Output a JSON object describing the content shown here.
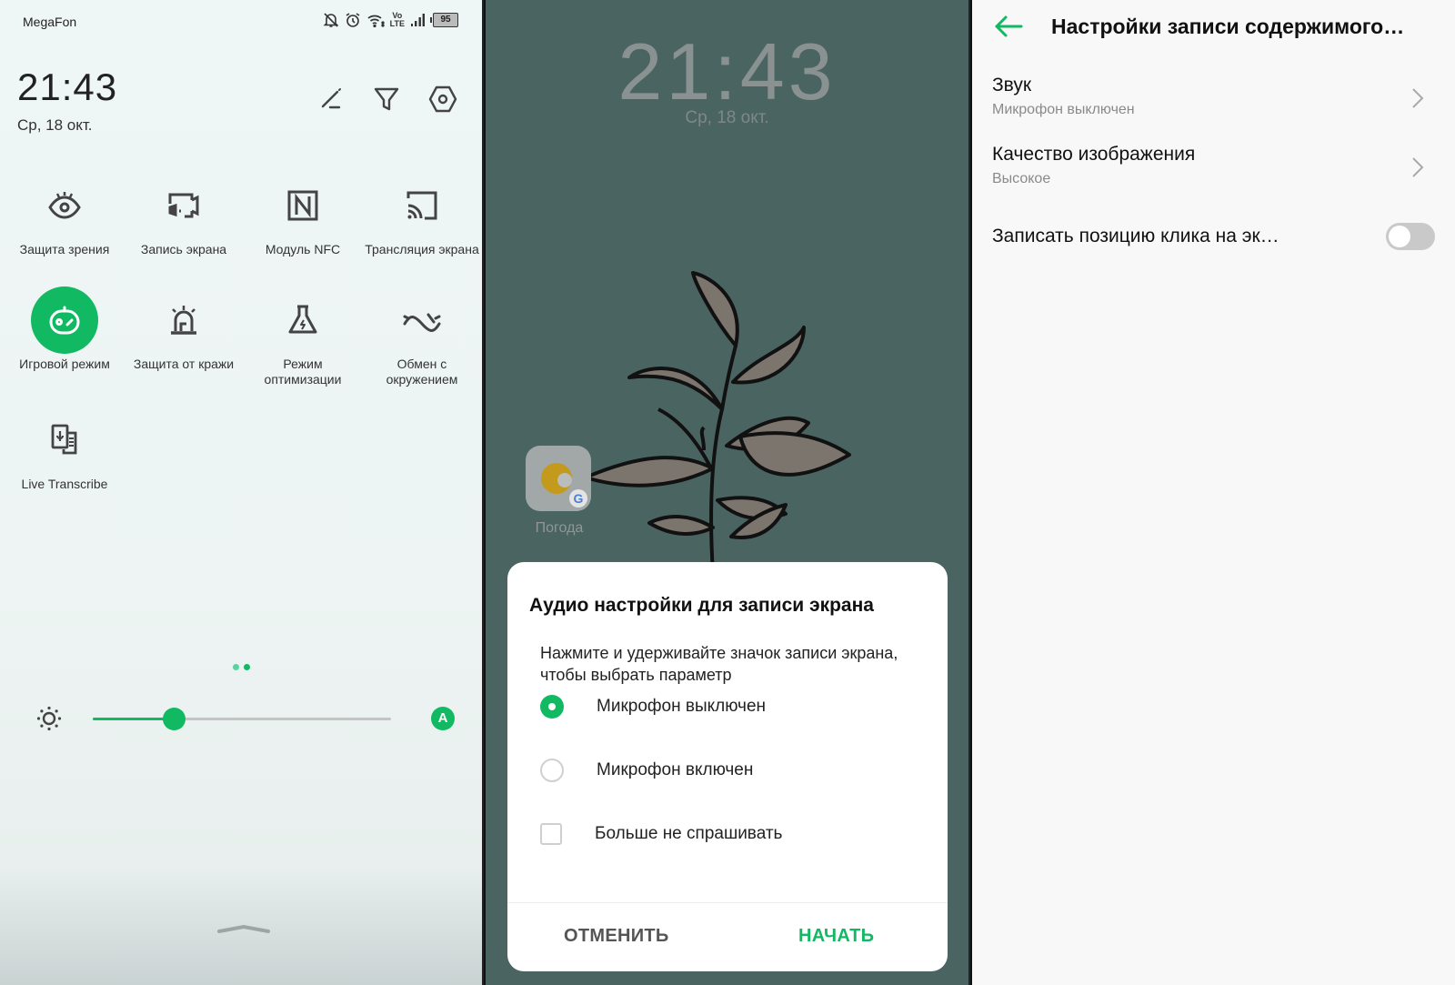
{
  "quick_settings": {
    "status_bar": {
      "carrier": "MegaFon",
      "icons": [
        "bell-off-icon",
        "alarm-icon",
        "wifi-icon",
        "volte-icon",
        "signal-icon",
        "battery-icon"
      ],
      "volte_top": "Vo",
      "volte_bottom": "LTE",
      "battery_level": "95"
    },
    "time": "21:43",
    "date": "Ср, 18 окт.",
    "header_actions": [
      "edit-icon",
      "filter-icon",
      "settings-icon"
    ],
    "tiles": [
      {
        "label": "Защита зрения",
        "icon": "eye-icon",
        "active": false
      },
      {
        "label": "Запись экрана",
        "icon": "screen-record-icon",
        "active": false
      },
      {
        "label": "Модуль NFC",
        "icon": "nfc-icon",
        "active": false
      },
      {
        "label": "Трансляция экрана",
        "icon": "cast-icon",
        "active": false
      },
      {
        "label": "Игровой режим",
        "icon": "game-mode-icon",
        "active": true
      },
      {
        "label": "Защита от кражи",
        "icon": "alarm-siren-icon",
        "active": false
      },
      {
        "label": "Режим оптимизации",
        "icon": "flask-icon",
        "active": false
      },
      {
        "label": "Обмен с окружением",
        "icon": "nearby-share-icon",
        "active": false
      },
      {
        "label": "Live Transcribe",
        "icon": "live-transcribe-icon",
        "active": false
      }
    ],
    "page_indicator": {
      "pages": 2,
      "current": 2
    },
    "brightness": {
      "value_fraction": 0.27,
      "auto_label": "A"
    },
    "accent_color": "#10b962"
  },
  "lock_screen": {
    "time": "21:43",
    "date": "Ср, 18 окт.",
    "app": {
      "label": "Погода",
      "icon": "weather-app-icon"
    },
    "dialog": {
      "title": "Аудио настройки для записи экрана",
      "description": "Нажмите и удерживайте значок записи экрана, чтобы выбрать параметр",
      "options": [
        {
          "label": "Микрофон выключен",
          "type": "radio",
          "selected": true
        },
        {
          "label": "Микрофон включен",
          "type": "radio",
          "selected": false
        }
      ],
      "dont_ask": {
        "label": "Больше не спрашивать",
        "checked": false
      },
      "cancel_label": "ОТМЕНИТЬ",
      "start_label": "НАЧАТЬ"
    }
  },
  "settings": {
    "title": "Настройки записи содержимого…",
    "rows": [
      {
        "title": "Звук",
        "subtitle": "Микрофон выключен",
        "type": "link"
      },
      {
        "title": "Качество изображения",
        "subtitle": "Высокое",
        "type": "link"
      },
      {
        "title": "Записать позицию клика на эк…",
        "type": "toggle",
        "on": false
      }
    ]
  }
}
